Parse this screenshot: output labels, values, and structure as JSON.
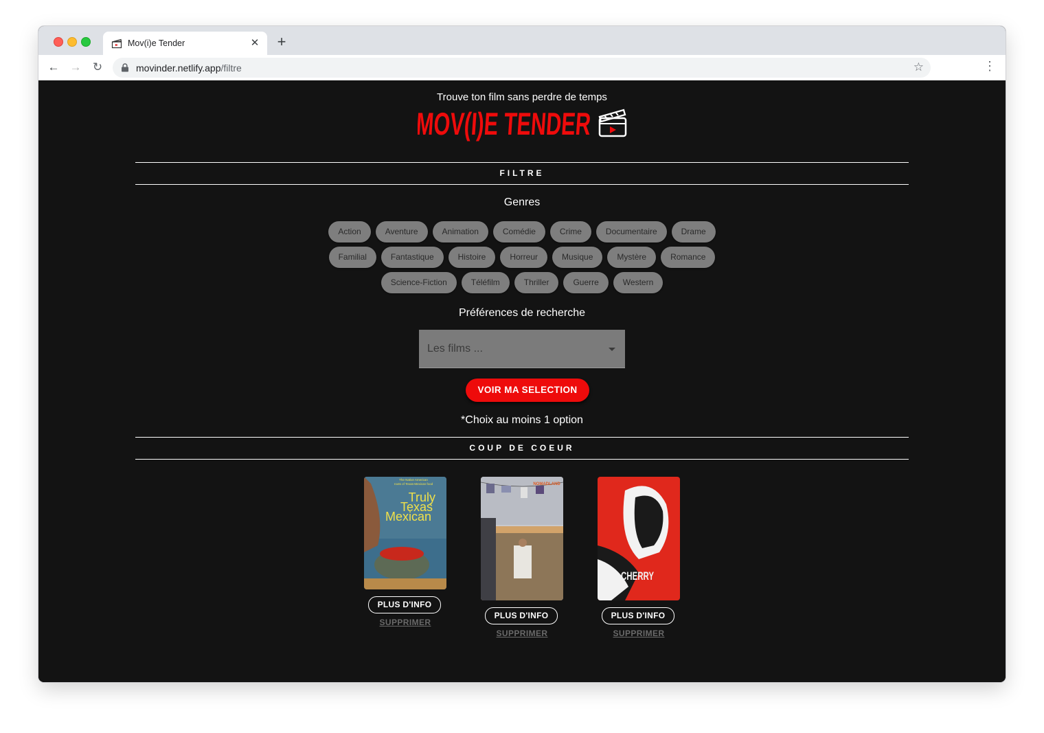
{
  "browser": {
    "tab_title": "Mov(i)e Tender",
    "url_host": "movinder.netlify.app",
    "url_path": "/filtre"
  },
  "header": {
    "tagline": "Trouve ton film sans perdre de temps",
    "logo_text": "MOV(I)E TENDER"
  },
  "filter": {
    "section_title": "FILTRE",
    "genres_label": "Genres",
    "genre_rows": [
      [
        "Action",
        "Aventure",
        "Animation",
        "Comédie",
        "Crime",
        "Documentaire",
        "Drame"
      ],
      [
        "Familial",
        "Fantastique",
        "Histoire",
        "Horreur",
        "Musique",
        "Mystère",
        "Romance"
      ],
      [
        "Science-Fiction",
        "Téléfilm",
        "Thriller",
        "Guerre",
        "Western"
      ]
    ],
    "preferences_label": "Préférences de recherche",
    "select_placeholder": "Les films ...",
    "cta_label": "VOIR MA SELECTION",
    "note": "*Choix au moins 1 option"
  },
  "favorites": {
    "section_title": "COUP DE COEUR",
    "info_label": "PLUS D'INFO",
    "delete_label": "SUPPRIMER",
    "items": [
      {
        "poster_lines": [
          "The Native American",
          "roots of Texas-Mexican food"
        ],
        "poster_title_lines": [
          "Truly",
          "Texas",
          "Mexican"
        ]
      },
      {
        "poster_title": "NOMADLAND"
      },
      {
        "poster_title": "CHERRY"
      }
    ]
  },
  "colors": {
    "page_bg": "#131313",
    "accent_red": "#ee0b0b",
    "chip_bg": "#7e7e7e",
    "select_bg": "#7b7b7b"
  },
  "icons": [
    "clapperboard-icon",
    "lock-icon",
    "star-icon",
    "back-arrow-icon",
    "forward-arrow-icon",
    "reload-icon",
    "close-icon",
    "plus-icon",
    "menu-dots-icon"
  ]
}
